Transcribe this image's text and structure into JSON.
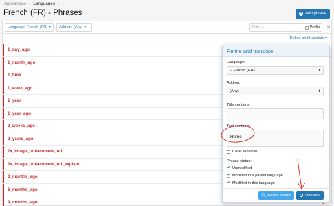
{
  "breadcrumb": [
    "Appearance",
    "Languages"
  ],
  "page_title": "French (FR) - Phrases",
  "add_button": "Add phrase",
  "filters": {
    "language": "Language: French (FR)",
    "addon": "Add-on: (Any)",
    "search_placeholder": "Filter...",
    "prefix_label": "Prefix"
  },
  "refine_toggle": "Refine and translate",
  "phrases": [
    "1_day_ago",
    "1_month_ago",
    "1_time",
    "1_week_ago",
    "1_year",
    "1_year_ago",
    "2_weeks_ago",
    "2_years_ago",
    "2x_image_replacement_url",
    "2x_image_replacement_url_explain",
    "3_months_ago",
    "6_months_ago",
    "9_months_ago"
  ],
  "popup": {
    "title": "Refine and translate",
    "language_label": "Language:",
    "language_value": "-- French (FR)",
    "addon_label": "Add-on:",
    "addon_value": "(Any)",
    "title_contains_label": "Title contains:",
    "title_contains_value": "",
    "text_contains_label": "Text contains:",
    "text_contains_value": "Home",
    "case_sensitive": "Case sensitive",
    "phrase_status_label": "Phrase status:",
    "status_options": [
      "Unmodified",
      "Modified in a parent language",
      "Modified in this language"
    ],
    "refine_button": "Refine search",
    "translate_button": "Translate"
  },
  "colors": {
    "accent": "#2577b1",
    "accent_light": "#47a7eb",
    "phrase_red": "#c42d2d",
    "annotation_red": "#d9342b"
  }
}
